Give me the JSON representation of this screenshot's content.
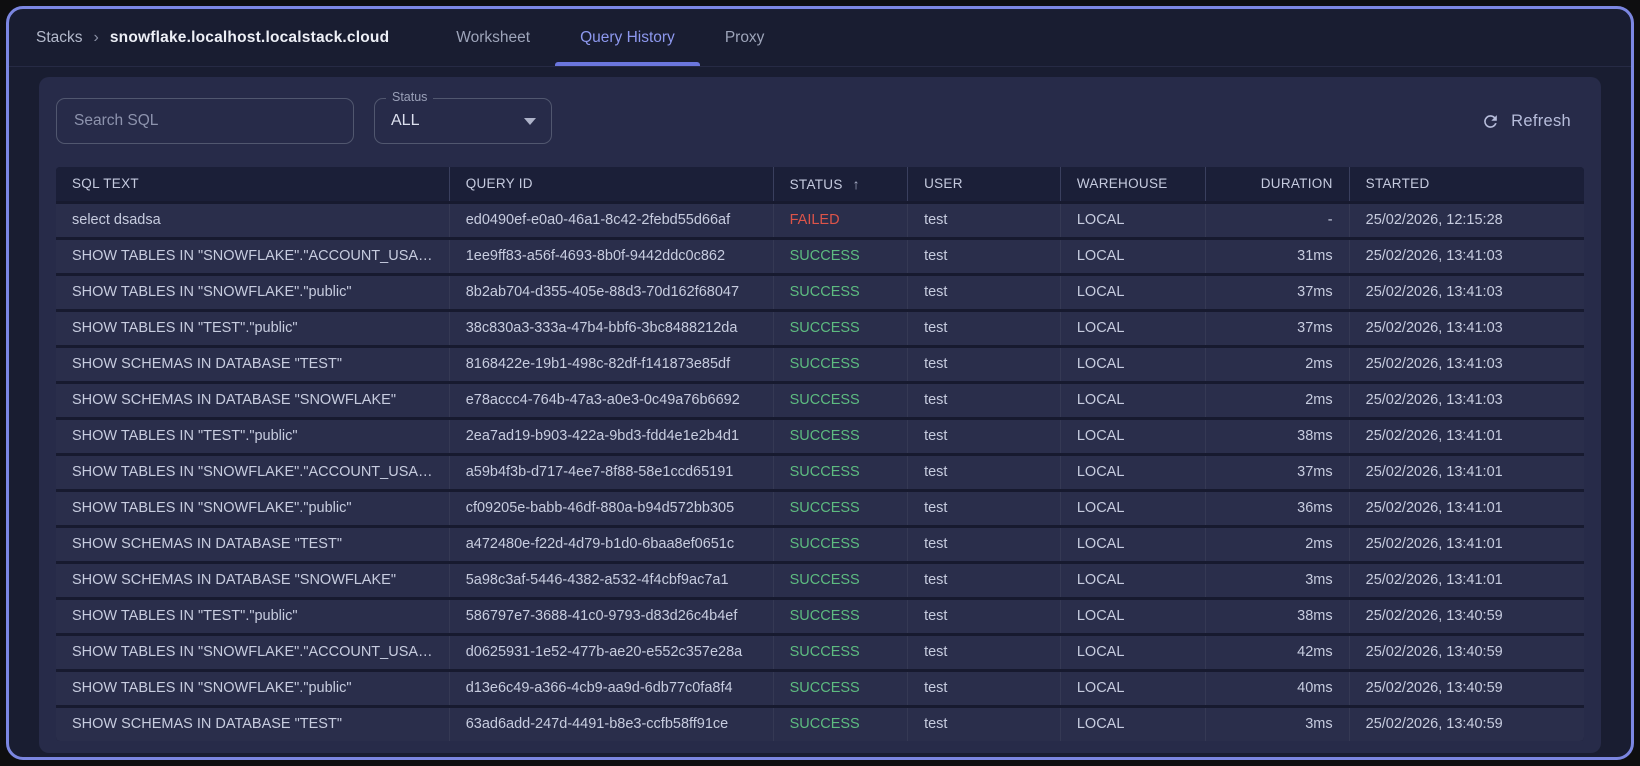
{
  "header": {
    "breadcrumb": {
      "root": "Stacks",
      "separator": "›",
      "current": "snowflake.localhost.localstack.cloud"
    },
    "tabs": [
      {
        "label": "Worksheet",
        "active": false
      },
      {
        "label": "Query History",
        "active": true
      },
      {
        "label": "Proxy",
        "active": false
      }
    ]
  },
  "toolbar": {
    "search_placeholder": "Search SQL",
    "status_filter": {
      "label": "Status",
      "value": "ALL"
    },
    "refresh_label": "Refresh"
  },
  "table": {
    "columns": [
      "SQL TEXT",
      "QUERY ID",
      "STATUS",
      "USER",
      "WAREHOUSE",
      "DURATION",
      "STARTED"
    ],
    "sort": {
      "column": "STATUS",
      "direction": "asc",
      "icon": "↑"
    },
    "rows": [
      {
        "sql": "select dsadsa",
        "query_id": "ed0490ef-e0a0-46a1-8c42-2febd55d66af",
        "status": "FAILED",
        "user": "test",
        "warehouse": "LOCAL",
        "duration": "-",
        "started": "25/02/2026, 12:15:28"
      },
      {
        "sql": "SHOW TABLES IN \"SNOWFLAKE\".\"ACCOUNT_USAGE\"",
        "query_id": "1ee9ff83-a56f-4693-8b0f-9442ddc0c862",
        "status": "SUCCESS",
        "user": "test",
        "warehouse": "LOCAL",
        "duration": "31ms",
        "started": "25/02/2026, 13:41:03"
      },
      {
        "sql": "SHOW TABLES IN \"SNOWFLAKE\".\"public\"",
        "query_id": "8b2ab704-d355-405e-88d3-70d162f68047",
        "status": "SUCCESS",
        "user": "test",
        "warehouse": "LOCAL",
        "duration": "37ms",
        "started": "25/02/2026, 13:41:03"
      },
      {
        "sql": "SHOW TABLES IN \"TEST\".\"public\"",
        "query_id": "38c830a3-333a-47b4-bbf6-3bc8488212da",
        "status": "SUCCESS",
        "user": "test",
        "warehouse": "LOCAL",
        "duration": "37ms",
        "started": "25/02/2026, 13:41:03"
      },
      {
        "sql": "SHOW SCHEMAS IN DATABASE \"TEST\"",
        "query_id": "8168422e-19b1-498c-82df-f141873e85df",
        "status": "SUCCESS",
        "user": "test",
        "warehouse": "LOCAL",
        "duration": "2ms",
        "started": "25/02/2026, 13:41:03"
      },
      {
        "sql": "SHOW SCHEMAS IN DATABASE \"SNOWFLAKE\"",
        "query_id": "e78accc4-764b-47a3-a0e3-0c49a76b6692",
        "status": "SUCCESS",
        "user": "test",
        "warehouse": "LOCAL",
        "duration": "2ms",
        "started": "25/02/2026, 13:41:03"
      },
      {
        "sql": "SHOW TABLES IN \"TEST\".\"public\"",
        "query_id": "2ea7ad19-b903-422a-9bd3-fdd4e1e2b4d1",
        "status": "SUCCESS",
        "user": "test",
        "warehouse": "LOCAL",
        "duration": "38ms",
        "started": "25/02/2026, 13:41:01"
      },
      {
        "sql": "SHOW TABLES IN \"SNOWFLAKE\".\"ACCOUNT_USAGE\"",
        "query_id": "a59b4f3b-d717-4ee7-8f88-58e1ccd65191",
        "status": "SUCCESS",
        "user": "test",
        "warehouse": "LOCAL",
        "duration": "37ms",
        "started": "25/02/2026, 13:41:01"
      },
      {
        "sql": "SHOW TABLES IN \"SNOWFLAKE\".\"public\"",
        "query_id": "cf09205e-babb-46df-880a-b94d572bb305",
        "status": "SUCCESS",
        "user": "test",
        "warehouse": "LOCAL",
        "duration": "36ms",
        "started": "25/02/2026, 13:41:01"
      },
      {
        "sql": "SHOW SCHEMAS IN DATABASE \"TEST\"",
        "query_id": "a472480e-f22d-4d79-b1d0-6baa8ef0651c",
        "status": "SUCCESS",
        "user": "test",
        "warehouse": "LOCAL",
        "duration": "2ms",
        "started": "25/02/2026, 13:41:01"
      },
      {
        "sql": "SHOW SCHEMAS IN DATABASE \"SNOWFLAKE\"",
        "query_id": "5a98c3af-5446-4382-a532-4f4cbf9ac7a1",
        "status": "SUCCESS",
        "user": "test",
        "warehouse": "LOCAL",
        "duration": "3ms",
        "started": "25/02/2026, 13:41:01"
      },
      {
        "sql": "SHOW TABLES IN \"TEST\".\"public\"",
        "query_id": "586797e7-3688-41c0-9793-d83d26c4b4ef",
        "status": "SUCCESS",
        "user": "test",
        "warehouse": "LOCAL",
        "duration": "38ms",
        "started": "25/02/2026, 13:40:59"
      },
      {
        "sql": "SHOW TABLES IN \"SNOWFLAKE\".\"ACCOUNT_USAGE\"",
        "query_id": "d0625931-1e52-477b-ae20-e552c357e28a",
        "status": "SUCCESS",
        "user": "test",
        "warehouse": "LOCAL",
        "duration": "42ms",
        "started": "25/02/2026, 13:40:59"
      },
      {
        "sql": "SHOW TABLES IN \"SNOWFLAKE\".\"public\"",
        "query_id": "d13e6c49-a366-4cb9-aa9d-6db77c0fa8f4",
        "status": "SUCCESS",
        "user": "test",
        "warehouse": "LOCAL",
        "duration": "40ms",
        "started": "25/02/2026, 13:40:59"
      },
      {
        "sql": "SHOW SCHEMAS IN DATABASE \"TEST\"",
        "query_id": "63ad6add-247d-4491-b8e3-ccfb58ff91ce",
        "status": "SUCCESS",
        "user": "test",
        "warehouse": "LOCAL",
        "duration": "3ms",
        "started": "25/02/2026, 13:40:59"
      }
    ]
  },
  "colors": {
    "accent": "#7b86e0",
    "success": "#5dbb80",
    "failed": "#dd5449"
  }
}
